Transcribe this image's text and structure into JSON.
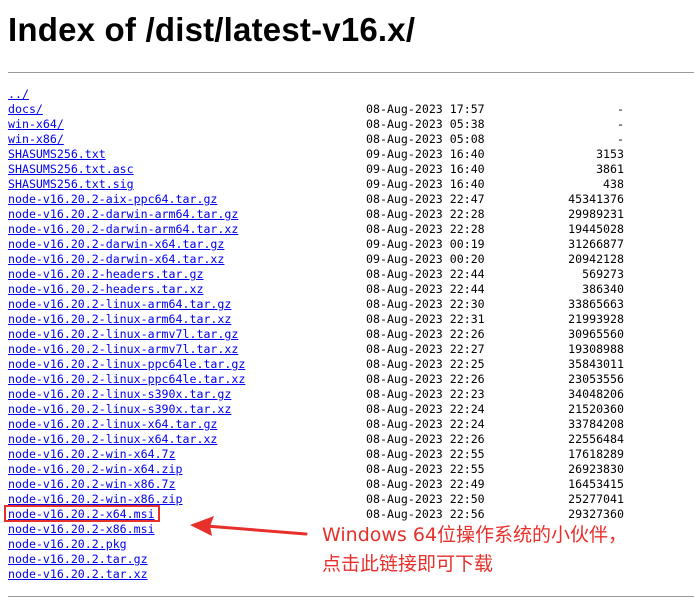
{
  "page": {
    "title": "Index of /dist/latest-v16.x/"
  },
  "listing": [
    {
      "name": "../",
      "date": "",
      "size": ""
    },
    {
      "name": "docs/",
      "date": "08-Aug-2023 17:57",
      "size": "-"
    },
    {
      "name": "win-x64/",
      "date": "08-Aug-2023 05:38",
      "size": "-"
    },
    {
      "name": "win-x86/",
      "date": "08-Aug-2023 05:08",
      "size": "-"
    },
    {
      "name": "SHASUMS256.txt",
      "date": "09-Aug-2023 16:40",
      "size": "3153"
    },
    {
      "name": "SHASUMS256.txt.asc",
      "date": "09-Aug-2023 16:40",
      "size": "3861"
    },
    {
      "name": "SHASUMS256.txt.sig",
      "date": "09-Aug-2023 16:40",
      "size": "438"
    },
    {
      "name": "node-v16.20.2-aix-ppc64.tar.gz",
      "date": "08-Aug-2023 22:47",
      "size": "45341376"
    },
    {
      "name": "node-v16.20.2-darwin-arm64.tar.gz",
      "date": "08-Aug-2023 22:28",
      "size": "29989231"
    },
    {
      "name": "node-v16.20.2-darwin-arm64.tar.xz",
      "date": "08-Aug-2023 22:28",
      "size": "19445028"
    },
    {
      "name": "node-v16.20.2-darwin-x64.tar.gz",
      "date": "09-Aug-2023 00:19",
      "size": "31266877"
    },
    {
      "name": "node-v16.20.2-darwin-x64.tar.xz",
      "date": "09-Aug-2023 00:20",
      "size": "20942128"
    },
    {
      "name": "node-v16.20.2-headers.tar.gz",
      "date": "08-Aug-2023 22:44",
      "size": "569273"
    },
    {
      "name": "node-v16.20.2-headers.tar.xz",
      "date": "08-Aug-2023 22:44",
      "size": "386340"
    },
    {
      "name": "node-v16.20.2-linux-arm64.tar.gz",
      "date": "08-Aug-2023 22:30",
      "size": "33865663"
    },
    {
      "name": "node-v16.20.2-linux-arm64.tar.xz",
      "date": "08-Aug-2023 22:31",
      "size": "21993928"
    },
    {
      "name": "node-v16.20.2-linux-armv7l.tar.gz",
      "date": "08-Aug-2023 22:26",
      "size": "30965560"
    },
    {
      "name": "node-v16.20.2-linux-armv7l.tar.xz",
      "date": "08-Aug-2023 22:27",
      "size": "19308988"
    },
    {
      "name": "node-v16.20.2-linux-ppc64le.tar.gz",
      "date": "08-Aug-2023 22:25",
      "size": "35843011"
    },
    {
      "name": "node-v16.20.2-linux-ppc64le.tar.xz",
      "date": "08-Aug-2023 22:26",
      "size": "23053556"
    },
    {
      "name": "node-v16.20.2-linux-s390x.tar.gz",
      "date": "08-Aug-2023 22:23",
      "size": "34048206"
    },
    {
      "name": "node-v16.20.2-linux-s390x.tar.xz",
      "date": "08-Aug-2023 22:24",
      "size": "21520360"
    },
    {
      "name": "node-v16.20.2-linux-x64.tar.gz",
      "date": "08-Aug-2023 22:24",
      "size": "33784208"
    },
    {
      "name": "node-v16.20.2-linux-x64.tar.xz",
      "date": "08-Aug-2023 22:26",
      "size": "22556484"
    },
    {
      "name": "node-v16.20.2-win-x64.7z",
      "date": "08-Aug-2023 22:55",
      "size": "17618289"
    },
    {
      "name": "node-v16.20.2-win-x64.zip",
      "date": "08-Aug-2023 22:55",
      "size": "26923830"
    },
    {
      "name": "node-v16.20.2-win-x86.7z",
      "date": "08-Aug-2023 22:49",
      "size": "16453415"
    },
    {
      "name": "node-v16.20.2-win-x86.zip",
      "date": "08-Aug-2023 22:50",
      "size": "25277041"
    },
    {
      "name": "node-v16.20.2-x64.msi",
      "date": "08-Aug-2023 22:56",
      "size": "29327360"
    },
    {
      "name": "node-v16.20.2-x86.msi",
      "date": "",
      "size": ""
    },
    {
      "name": "node-v16.20.2.pkg",
      "date": "",
      "size": ""
    },
    {
      "name": "node-v16.20.2.tar.gz",
      "date": "",
      "size": ""
    },
    {
      "name": "node-v16.20.2.tar.xz",
      "date": "",
      "size": ""
    }
  ],
  "annotation": {
    "line1": "Windows 64位操作系统的小伙伴，",
    "line2": "点击此链接即可下载",
    "color": "#e8302b"
  },
  "colors": {
    "link": "#0000ee",
    "highlight": "#e8302b"
  }
}
